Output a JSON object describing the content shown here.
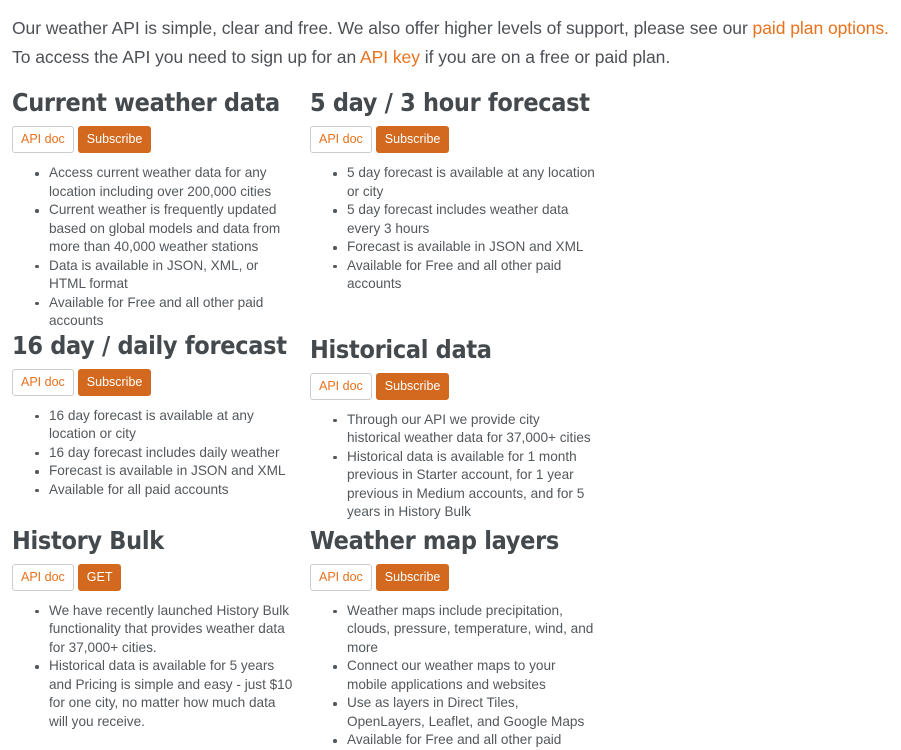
{
  "intro": {
    "part1": "Our weather API is simple, clear and free. We also offer higher levels of support, please see our ",
    "link1": "paid plan options.",
    "part2": " To access the API you need to sign up for an ",
    "link2": "API key",
    "part3": " if you are on a free or paid plan."
  },
  "colors": {
    "link": "#e9711c",
    "primary_button_bg": "#d2691e",
    "primary_button_text": "#ffffff",
    "doc_button_border": "#cccccc",
    "text": "#53585c",
    "heading": "#44494d"
  },
  "blocks": [
    {
      "title": "Current weather data",
      "doc_label": "API doc",
      "action_label": "Subscribe",
      "items": [
        "Access current weather data for any location including over 200,000 cities",
        "Current weather is frequently updated based on global models and data from more than 40,000 weather stations",
        "Data is available in JSON, XML, or HTML format",
        "Available for Free and all other paid accounts"
      ]
    },
    {
      "title": "5 day / 3 hour forecast",
      "doc_label": "API doc",
      "action_label": "Subscribe",
      "items": [
        "5 day forecast is available at any location or city",
        "5 day forecast includes weather data every 3 hours",
        "Forecast is available in JSON and XML",
        "Available for Free and all other paid accounts"
      ]
    },
    {
      "title": "16 day / daily forecast",
      "doc_label": "API doc",
      "action_label": "Subscribe",
      "items": [
        "16 day forecast is available at any location or city",
        "16 day forecast includes daily weather",
        "Forecast is available in JSON and XML",
        "Available for all paid accounts"
      ]
    },
    {
      "title": "Historical data",
      "doc_label": "API doc",
      "action_label": "Subscribe",
      "items": [
        "Through our API we provide city historical weather data for 37,000+ cities",
        "Historical data is available for 1 month previous in Starter account, for 1 year previous in Medium accounts, and for 5 years in History Bulk"
      ]
    },
    {
      "title": "History Bulk",
      "doc_label": "API doc",
      "action_label": "GET",
      "items": [
        "We have recently launched History Bulk functionality that provides weather data for 37,000+ cities.",
        "Historical data is available for 5 years and Pricing is simple and easy - just $10 for one city, no matter how much data will you receive."
      ]
    },
    {
      "title": "Weather map layers",
      "doc_label": "API doc",
      "action_label": "Subscribe",
      "items": [
        "Weather maps include precipitation, clouds, pressure, temperature, wind, and more",
        "Connect our weather maps to your mobile applications and websites",
        "Use as layers in Direct Tiles, OpenLayers, Leaflet, and Google Maps",
        "Available for Free and all other paid"
      ]
    }
  ]
}
